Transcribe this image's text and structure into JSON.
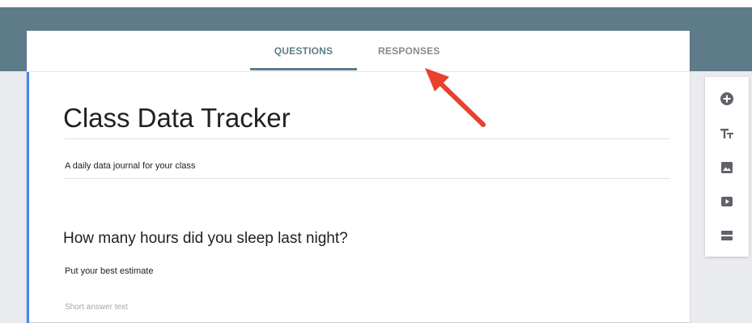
{
  "tabs": [
    {
      "label": "QUESTIONS",
      "active": true
    },
    {
      "label": "RESPONSES",
      "active": false
    }
  ],
  "form": {
    "title": "Class Data Tracker",
    "description": "A daily data journal for your class"
  },
  "question": {
    "title": "How many hours did you sleep last night?",
    "help_text": "Put your best estimate",
    "answer_placeholder": "Short answer text"
  },
  "toolbar": {
    "icons": [
      "add-question-icon",
      "add-title-text-icon",
      "add-image-icon",
      "add-video-icon",
      "add-section-icon"
    ]
  },
  "colors": {
    "header": "#5e7b8a",
    "active_tab": "#5e7b8a",
    "section_accent": "#4285f4",
    "arrow": "#e8412c",
    "icon": "#5f6368"
  }
}
